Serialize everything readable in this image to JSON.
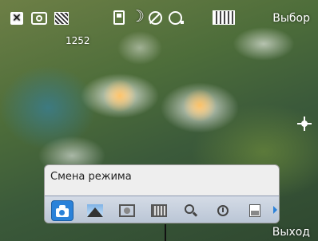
{
  "status_bar": {
    "icons": [
      "close-icon",
      "camera-icon",
      "quality-icon",
      "memory-card-icon",
      "night-mode-icon",
      "flash-off-icon",
      "self-timer-icon",
      "resolution-icon"
    ],
    "close_glyph": "✕",
    "night_glyph": "☽",
    "select_label": "Выбор"
  },
  "viewfinder": {
    "shots_remaining": "1252"
  },
  "mode_panel": {
    "title": "Смена режима",
    "modes": [
      "auto-mode-icon",
      "landscape-mode-icon",
      "frame-mode-icon",
      "multishot-mode-icon",
      "closeup-mode-icon",
      "timer-mode-icon",
      "document-mode-icon"
    ],
    "selected_index": 0,
    "accent": "#2b82d9"
  },
  "softkeys": {
    "right": "Выход"
  }
}
